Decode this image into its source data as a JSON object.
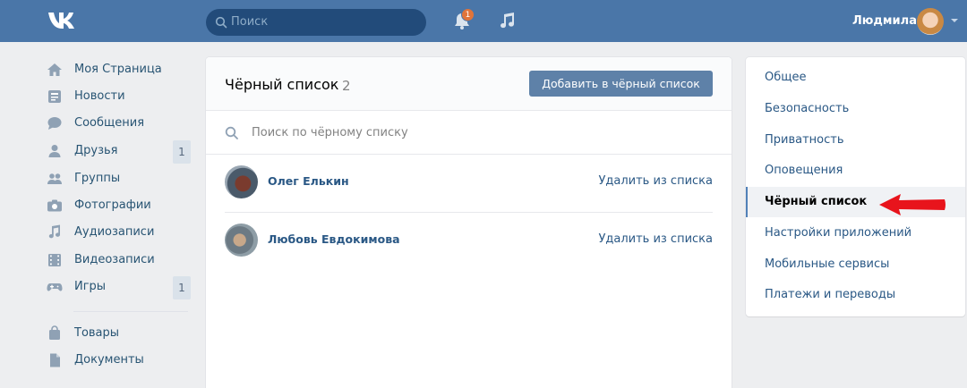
{
  "header": {
    "search_placeholder": "Поиск",
    "notification_count": "1",
    "user_name": "Людмила",
    "icons": {
      "logo": "vk-logo",
      "search": "search-icon",
      "bell": "bell-icon",
      "music": "music-icon"
    }
  },
  "left_menu": {
    "items": [
      {
        "label": "Моя Страница",
        "icon": "home-icon",
        "count": ""
      },
      {
        "label": "Новости",
        "icon": "news-icon",
        "count": ""
      },
      {
        "label": "Сообщения",
        "icon": "messages-icon",
        "count": ""
      },
      {
        "label": "Друзья",
        "icon": "friends-icon",
        "count": "1"
      },
      {
        "label": "Группы",
        "icon": "groups-icon",
        "count": ""
      },
      {
        "label": "Фотографии",
        "icon": "camera-icon",
        "count": ""
      },
      {
        "label": "Аудиозаписи",
        "icon": "music-note-icon",
        "count": ""
      },
      {
        "label": "Видеозаписи",
        "icon": "film-icon",
        "count": ""
      },
      {
        "label": "Игры",
        "icon": "gamepad-icon",
        "count": "1"
      },
      {
        "label": "Товары",
        "icon": "bag-icon",
        "count": ""
      },
      {
        "label": "Документы",
        "icon": "document-icon",
        "count": ""
      }
    ]
  },
  "blacklist": {
    "title": "Чёрный список",
    "count": "2",
    "add_button": "Добавить в чёрный список",
    "search_placeholder": "Поиск по чёрному списку",
    "entries": [
      {
        "name": "Олег Елькин",
        "action": "Удалить из списка"
      },
      {
        "name": "Любовь Евдокимова",
        "action": "Удалить из списка"
      }
    ]
  },
  "settings_menu": {
    "items": [
      {
        "label": "Общее"
      },
      {
        "label": "Безопасность"
      },
      {
        "label": "Приватность"
      },
      {
        "label": "Оповещения"
      },
      {
        "label": "Чёрный список",
        "active": true
      },
      {
        "label": "Настройки приложений"
      },
      {
        "label": "Мобильные сервисы"
      },
      {
        "label": "Платежи и переводы"
      }
    ]
  },
  "colors": {
    "header_bg": "#4a76a8",
    "link": "#2a5885",
    "button": "#5e81a8",
    "page_bg": "#edeef0",
    "arrow": "#e8141c"
  }
}
